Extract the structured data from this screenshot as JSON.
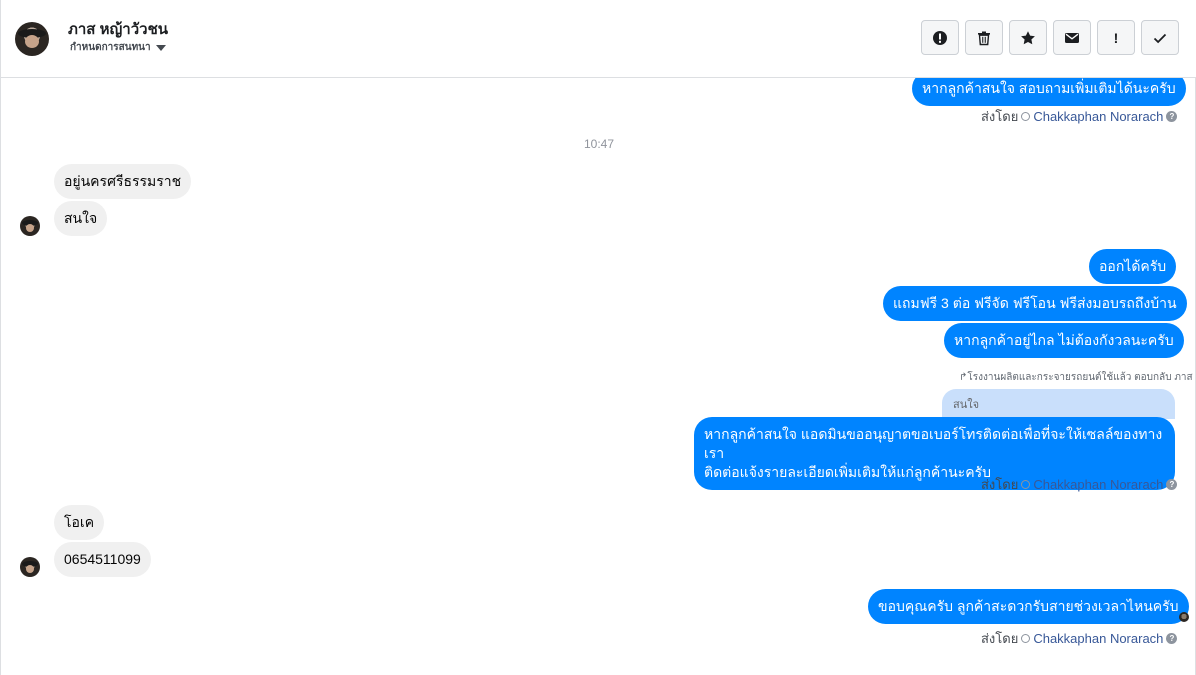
{
  "header": {
    "contact_name": "ภาส หญ้าวัวชน",
    "assign_label": "กำหนดการสนทนา",
    "actions": [
      {
        "name": "mark-spam-button",
        "icon": "alert-circle-icon"
      },
      {
        "name": "delete-button",
        "icon": "trash-icon"
      },
      {
        "name": "star-button",
        "icon": "star-icon"
      },
      {
        "name": "mark-unread-button",
        "icon": "envelope-icon"
      },
      {
        "name": "follow-up-button",
        "icon": "exclamation-icon",
        "text": "!"
      },
      {
        "name": "mark-done-button",
        "icon": "check-icon"
      }
    ]
  },
  "thread": {
    "top_partial_message": "หากลูกค้าสนใจ สอบถามเพิ่มเติมได้นะครับ",
    "sent_by_prefix": "ส่งโดย",
    "agent_name": "Chakkaphan Norarach",
    "timestamp": "10:47",
    "incoming_group_1": [
      "อยู่นครศรีธรรมราช",
      "สนใจ"
    ],
    "outgoing_group_1": [
      "ออกได้ครับ",
      "แถมฟรี 3 ต่อ ฟรีจัด ฟรีโอน  ฟรีส่งมอบรถถึงบ้าน",
      "หากลูกค้าอยู่ไกล ไม่ต้องกังวลนะครับ"
    ],
    "reply_meta": "โรงงานผลิตและกระจายรถยนต์ใช้แล้ว ตอบกลับ ภาส",
    "quoted_text": "สนใจ",
    "reply_message_line1": "หากลูกค้าสนใจ แอดมินขออนุญาตขอเบอร์โทรติดต่อเพื่อที่จะให้เซลล์ของทางเรา",
    "reply_message_line2": "ติดต่อแจ้งรายละเอียดเพิ่มเติมให้แก่ลูกค้านะครับ",
    "incoming_group_2": [
      "โอเค",
      "0654511099"
    ],
    "final_message": "ขอบคุณครับ ลูกค้าสะดวกรับสายช่วงเวลาไหนครับ"
  },
  "colors": {
    "outgoing_bubble": "#0084ff",
    "incoming_bubble": "#f0f0f0",
    "quoted_bubble": "#c9dffb",
    "agent_link": "#385898"
  }
}
